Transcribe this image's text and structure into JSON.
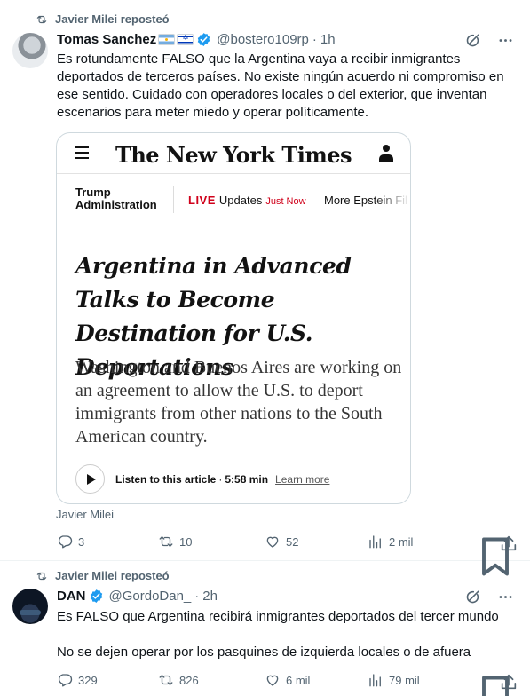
{
  "tweets": [
    {
      "repost_label": "Javier Milei reposteó",
      "author_name": "Tomas Sanchez",
      "handle": "@bostero109rp",
      "separator": "·",
      "time": "1h",
      "text": "Es rotundamente FALSO que la Argentina vaya a recibir inmigrantes deportados de terceros países. No existe ningún acuerdo ni compromiso en ese sentido. Cuidado con operadores locales o del exterior, que inventan escenarios para meter miedo y operar políticamente.",
      "card": {
        "masthead": "The New York Times",
        "nav": {
          "section": "Trump Administration",
          "live_tag": "LIVE",
          "live_text": "Updates",
          "live_time": "Just Now",
          "more": "More Epstein Fil"
        },
        "headline": "Argentina in Advanced Talks to Become Destination for U.S. Deportations",
        "summary": "Washington and Buenos Aires are working on an agreement to allow the U.S. to deport immigrants from other nations to the South American country.",
        "audio": {
          "label": "Listen to this article",
          "separator": "·",
          "duration": "5:58 min",
          "learn_more": "Learn more"
        }
      },
      "caption": "Javier Milei",
      "stats": {
        "replies": "3",
        "reposts": "10",
        "likes": "52",
        "views": "2 mil"
      }
    },
    {
      "repost_label": "Javier Milei reposteó",
      "author_name": "DAN",
      "handle": "@GordoDan_",
      "separator": "·",
      "time": "2h",
      "text_line1": "Es FALSO que Argentina recibirá inmigrantes deportados del tercer mundo",
      "text_line2": "No se dejen operar por los pasquines de izquierda locales o de afuera",
      "stats": {
        "replies": "329",
        "reposts": "826",
        "likes": "6 mil",
        "views": "79 mil"
      }
    }
  ],
  "icons": {
    "repost": "repost-icon",
    "verified": "verified-badge-icon",
    "grok": "grok-icon",
    "more": "more-icon",
    "reply": "reply-icon",
    "like": "like-icon",
    "views": "views-icon",
    "bookmark": "bookmark-icon",
    "share": "share-icon"
  },
  "colors": {
    "verified": "#1d9bf0",
    "muted": "#536471",
    "nyt_live": "#d0021b"
  }
}
